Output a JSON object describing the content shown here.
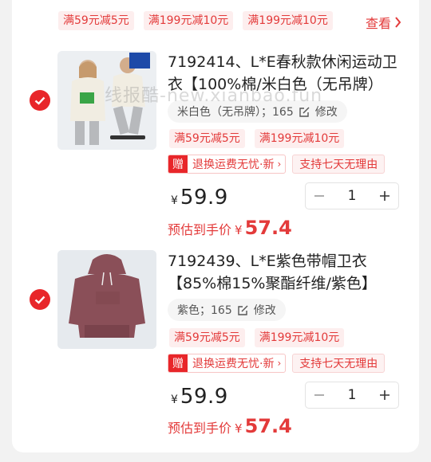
{
  "top_promos": [
    "满59元减5元",
    "满199元减10元",
    "满199元减10元"
  ],
  "see_more": "查看",
  "watermark": "线报酷-new.xianbao.fun",
  "items": [
    {
      "title": "7192414、L*E春秋款休闲运动卫衣【100%棉/米白色（无吊牌）",
      "spec": "米白色（无吊牌）；165",
      "edit": "修改",
      "promos": [
        "满59元减5元",
        "满199元减10元"
      ],
      "gift_badge": "赠",
      "service_1": "退换运费无忧·新",
      "service_2": "支持七天无理由",
      "currency": "¥",
      "price": "59.9",
      "quantity": "1",
      "est_label": "预估到手价",
      "est_price": "57.4",
      "brand": "Lee"
    },
    {
      "title": "7192439、L*E紫色带帽卫衣【85%棉15%聚酯纤维/紫色】",
      "spec": "紫色；165",
      "edit": "修改",
      "promos": [
        "满59元减5元",
        "满199元减10元"
      ],
      "gift_badge": "赠",
      "service_1": "退换运费无忧·新",
      "service_2": "支持七天无理由",
      "currency": "¥",
      "price": "59.9",
      "quantity": "1",
      "est_label": "预估到手价",
      "est_price": "57.4",
      "brand": "Lee"
    }
  ],
  "colors": {
    "accent": "#e8262a",
    "promo_bg": "#fdeeee",
    "hoodie_cream": "#f1ede2",
    "hoodie_mauve": "#8a4f58"
  }
}
